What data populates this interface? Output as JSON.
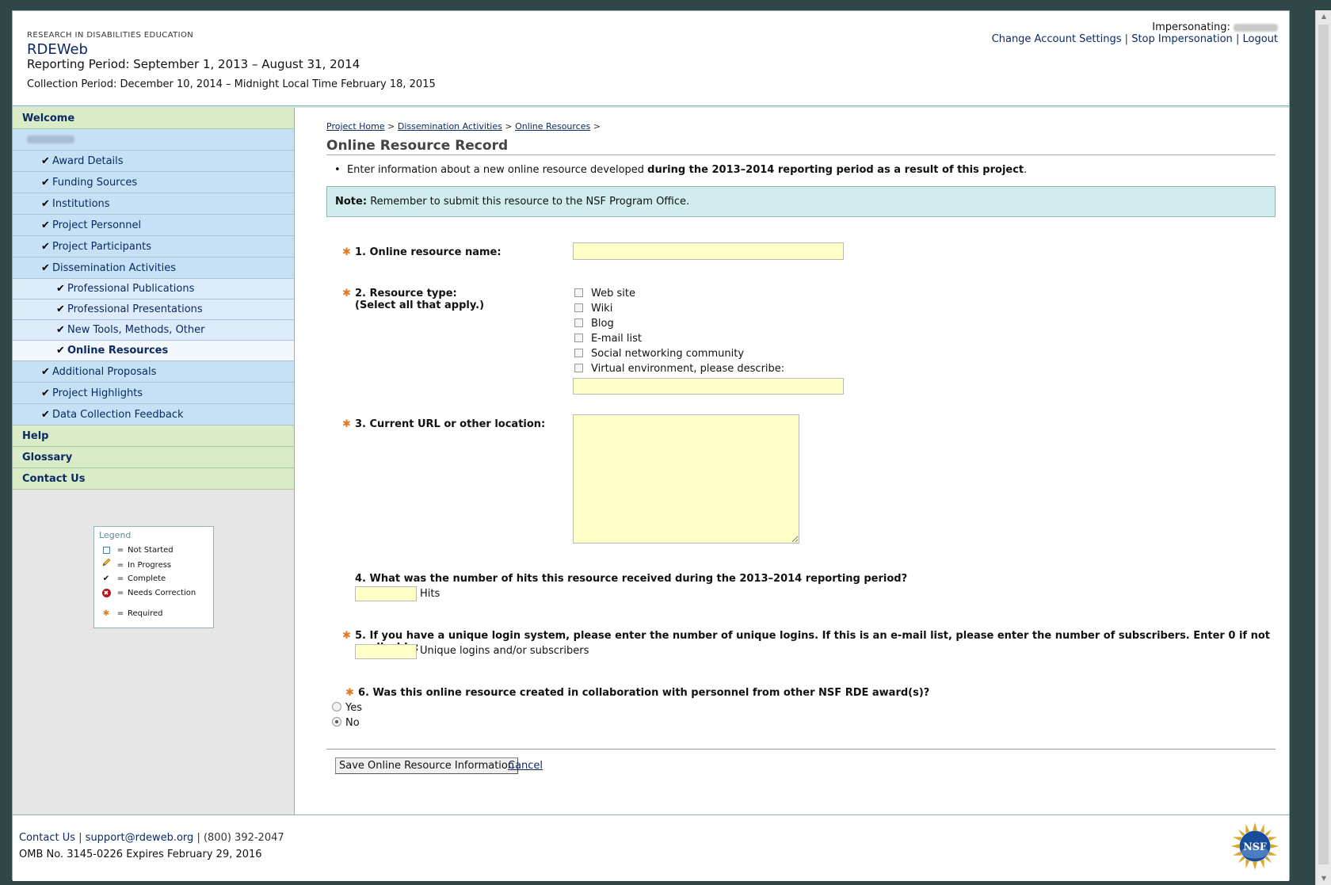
{
  "header": {
    "org": "RESEARCH IN DISABILITIES EDUCATION",
    "app_title": "RDEWeb",
    "reporting_period": "Reporting Period: September 1, 2013 – August 31, 2014",
    "collection_period": "Collection Period: December 10, 2014 – Midnight Local Time February 18, 2015",
    "impersonating_label": "Impersonating:",
    "links": {
      "change_account": "Change Account Settings",
      "stop_impersonation": "Stop Impersonation",
      "logout": "Logout",
      "separator": "|"
    }
  },
  "sidebar": {
    "welcome": "Welcome",
    "items": [
      {
        "label": "Award Details",
        "check": "✔"
      },
      {
        "label": "Funding Sources",
        "check": "✔"
      },
      {
        "label": "Institutions",
        "check": "✔"
      },
      {
        "label": "Project Personnel",
        "check": "✔"
      },
      {
        "label": "Project Participants",
        "check": "✔"
      },
      {
        "label": "Dissemination Activities",
        "check": "✔"
      }
    ],
    "sub_items": [
      {
        "label": "Professional Publications",
        "check": "✔"
      },
      {
        "label": "Professional Presentations",
        "check": "✔"
      },
      {
        "label": "New Tools, Methods, Other",
        "check": "✔"
      },
      {
        "label": "Online Resources",
        "check": "✔"
      }
    ],
    "items_after": [
      {
        "label": "Additional Proposals",
        "check": "✔"
      },
      {
        "label": "Project Highlights",
        "check": "✔"
      },
      {
        "label": "Data Collection Feedback",
        "check": "✔"
      }
    ],
    "help": "Help",
    "glossary": "Glossary",
    "contact": "Contact Us"
  },
  "legend": {
    "title": "Legend",
    "eq": "=",
    "rows": [
      "Not Started",
      "In Progress",
      "Complete",
      "Needs Correction",
      "Required"
    ],
    "check": "✔",
    "star": "✱",
    "x": "✖"
  },
  "breadcrumb": {
    "home": "Project Home",
    "dissemination": "Dissemination Activities",
    "online": "Online Resources",
    "sep": ">"
  },
  "page": {
    "title": "Online Resource Record",
    "intro_prefix": "Enter information about a new online resource developed ",
    "intro_bold": "during the 2013–2014 reporting period as a result of this project",
    "intro_suffix": ".",
    "bullet": "•",
    "note_label": "Note:",
    "note_text": "Remember to submit this resource to the NSF Program Office."
  },
  "form": {
    "required_mark": "✱",
    "q1": "1. Online resource name:",
    "q2_line1": "2. Resource type:",
    "q2_line2": "(Select all that apply.)",
    "resource_types": [
      "Web site",
      "Wiki",
      "Blog",
      "E-mail list",
      "Social networking community",
      "Virtual environment, please describe:"
    ],
    "q3": "3. Current URL or other location:",
    "q4": "4. What was the number of hits this resource received during the 2013–2014 reporting period?",
    "q4_unit": "Hits",
    "q5": "5. If you have a unique login system, please enter the number of unique logins. If this is an e-mail list, please enter the number of subscribers. Enter 0 if not applicable:",
    "q5_unit": "Unique logins and/or subscribers",
    "q6": "6. Was this online resource created in collaboration with personnel from other NSF RDE award(s)?",
    "q6_yes": "Yes",
    "q6_no": "No",
    "q6_selected": "No",
    "save_label": "Save Online Resource Information",
    "cancel_label": "Cancel"
  },
  "footer": {
    "contact": "Contact Us",
    "email": "support@rdeweb.org",
    "phone": "(800) 392-2047",
    "sep": "|",
    "omb": "OMB No. 3145-0226 Expires February 29, 2016",
    "logo_text": "NSF"
  },
  "colors": {
    "accent_navy": "#0b2a63",
    "nav_green": "#d9ecc7",
    "nav_blue": "#c6e0f5",
    "input_yellow": "#ffffc8",
    "note_bg": "#d0ecec",
    "required_orange": "#e07a1f"
  }
}
